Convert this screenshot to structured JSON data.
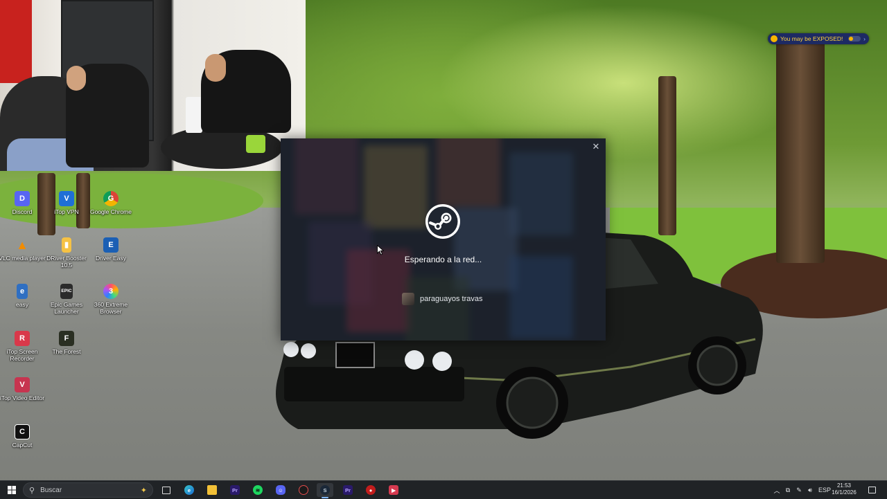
{
  "desktop": {
    "icons": [
      {
        "label": "Discord",
        "color": "#5865f2",
        "glyph": "D"
      },
      {
        "label": "iTop VPN",
        "color": "#1f6fd6",
        "glyph": "V"
      },
      {
        "label": "Google Chrome",
        "color": "#db4437",
        "glyph": "G"
      },
      {
        "label": "VLC media player",
        "color": "#f28c00",
        "glyph": "▲"
      },
      {
        "label": "DRiver Booster 10.5",
        "color": "#f6c244",
        "glyph": "▮"
      },
      {
        "label": "Driver Easy",
        "color": "#1b5fb4",
        "glyph": "E"
      },
      {
        "label": "easy",
        "color": "#2f6fc2",
        "glyph": "e"
      },
      {
        "label": "Epic Games Launcher",
        "color": "#2b2b2b",
        "glyph": "EPIC"
      },
      {
        "label": "360 Extreme Browser",
        "color": "#8a4fd8",
        "glyph": "3"
      },
      {
        "label": "iTop Screen Recorder",
        "color": "#d9384a",
        "glyph": "R"
      },
      {
        "label": "The Forest",
        "color": "#2a2f22",
        "glyph": "F"
      },
      {
        "label": "iTop Video Editor",
        "color": "#c7344f",
        "glyph": "V"
      },
      {
        "label": "CapCut",
        "color": "#111111",
        "glyph": "C"
      }
    ]
  },
  "steam_dialog": {
    "close_glyph": "✕",
    "status": "Esperando a la red...",
    "username": "paraguayos travas"
  },
  "exposed_badge": {
    "text": "You may be EXPOSED!",
    "color": "#ffd23c"
  },
  "taskbar": {
    "search_placeholder": "Buscar",
    "apps": [
      "task-view",
      "edge",
      "file-explorer",
      "premiere",
      "spotify",
      "discord",
      "capture",
      "steam",
      "premiere-2",
      "record",
      "itop-video"
    ],
    "tray_language": "ESP",
    "clock_time": "21:53",
    "clock_date": "16/1/2026"
  }
}
